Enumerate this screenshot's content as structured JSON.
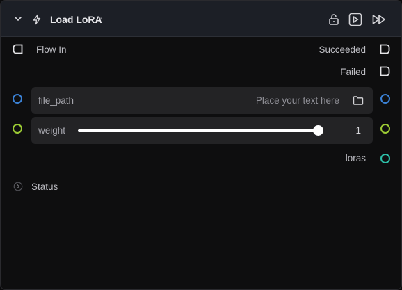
{
  "header": {
    "title": "Load LoRA",
    "modified_marker": "*"
  },
  "flow": {
    "in_label": "Flow In",
    "succeeded_label": "Succeeded",
    "failed_label": "Failed"
  },
  "inputs": {
    "file_path": {
      "label": "file_path",
      "placeholder": "Place your text here"
    },
    "weight": {
      "label": "weight",
      "value": "1",
      "fraction": 1.0
    }
  },
  "outputs": {
    "loras_label": "loras"
  },
  "status": {
    "label": "Status"
  },
  "colors": {
    "port_string": "#3b82d6",
    "port_float": "#9ccb34",
    "port_lora": "#2dbfa8",
    "header_bg": "#1c1f26"
  },
  "icons": [
    "chevron-down-icon",
    "lightning-icon",
    "unlock-icon",
    "run-node-icon",
    "run-from-here-icon",
    "folder-icon",
    "chevron-right-icon"
  ]
}
